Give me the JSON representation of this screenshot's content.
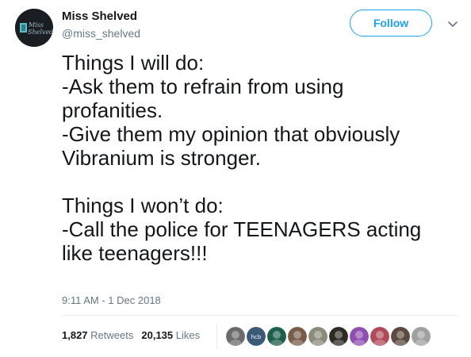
{
  "author": {
    "name": "Miss Shelved",
    "handle": "@miss_shelved",
    "avatar_text": "Miss Shelved"
  },
  "follow_label": "Follow",
  "tweet": {
    "lines": [
      "Things I will do:",
      "-Ask them to refrain from using",
      "profanities.",
      "-Give them my opinion that obviously",
      "Vibranium is stronger.",
      "",
      "Things I won’t do:",
      "-Call the police for TEENAGERS acting",
      "like teenagers!!!"
    ],
    "timestamp": "9:11 AM - 1 Dec 2018"
  },
  "stats": {
    "retweets_count": "1,827",
    "retweets_label": "Retweets",
    "likes_count": "20,135",
    "likes_label": "Likes"
  },
  "likers": [
    {
      "color": "#6b6b6b"
    },
    {
      "color": "#3b5a78",
      "text": "hcb"
    },
    {
      "color": "#1d5e4c"
    },
    {
      "color": "#7a5c4a"
    },
    {
      "color": "#8b8b7a"
    },
    {
      "color": "#2e2a26"
    },
    {
      "color": "#8e4fb0"
    },
    {
      "color": "#b04a5a"
    },
    {
      "color": "#5a4a40"
    },
    {
      "color": "#a0a0a0"
    }
  ],
  "colors": {
    "accent": "#1da1f2",
    "text": "#14171a",
    "muted": "#657786",
    "border": "#e6ecf0"
  }
}
